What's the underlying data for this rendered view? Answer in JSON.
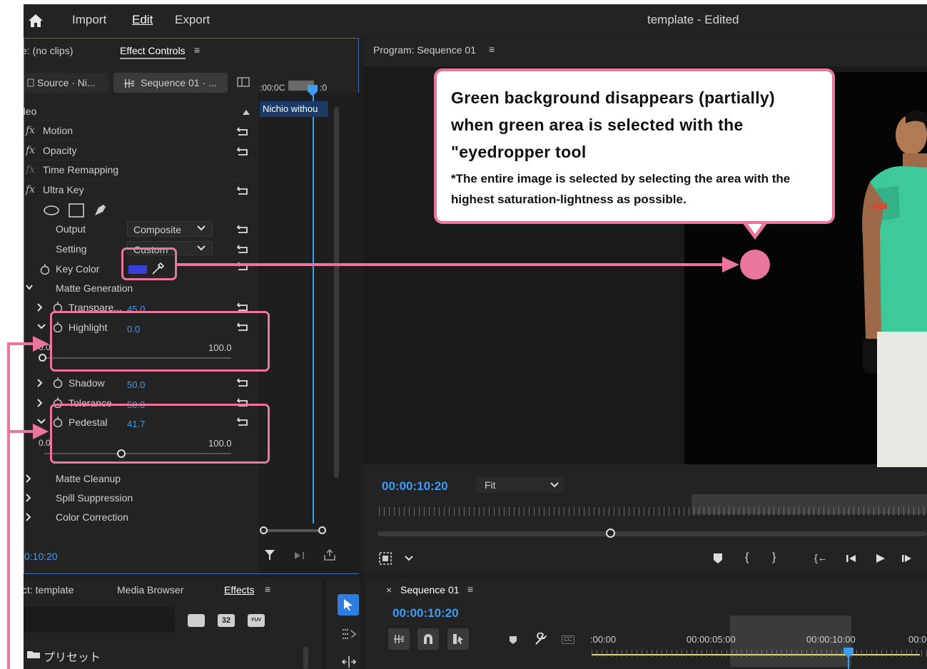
{
  "menu": {
    "import": "Import",
    "edit": "Edit",
    "export": "Export"
  },
  "app_title": "template - Edited",
  "left_panel": {
    "source_tab": "e: (no clips)",
    "effect_controls_tab": "Effect Controls",
    "source_clip_tab": "Source · Ni...",
    "sequence_tab": "Sequence 01 · ...",
    "timeline_tc": ":00:0C",
    "timeline_tc2": ":0",
    "clip_label": "Nichio withou",
    "section_video": "deo",
    "effects": {
      "motion": "Motion",
      "opacity": "Opacity",
      "time_remapping": "Time Remapping",
      "ultra_key": "Ultra Key"
    },
    "output_label": "Output",
    "output_value": "Composite",
    "setting_label": "Setting",
    "setting_value": "Custom",
    "key_color_label": "Key Color",
    "matte_generation": "Matte Generation",
    "transparency_label": "Transpare...",
    "transparency_value": "45.0",
    "highlight_label": "Highlight",
    "highlight_value": "0.0",
    "highlight_min": "0.0",
    "highlight_max": "100.0",
    "shadow_label": "Shadow",
    "shadow_value": "50.0",
    "tolerance_label": "Tolerance",
    "tolerance_value": "50.0",
    "pedestal_label": "Pedestal",
    "pedestal_value": "41.7",
    "pedestal_min": "0.0",
    "pedestal_max": "100.0",
    "matte_cleanup": "Matte Cleanup",
    "spill_suppression": "Spill Suppression",
    "color_correction": "Color Correction",
    "timecode": "0:10:20",
    "key_color_swatch": "#3a3fd6"
  },
  "program": {
    "title": "Program: Sequence 01",
    "timecode": "00:00:10:20",
    "fit": "Fit"
  },
  "bottom_left": {
    "project_tab": "ct: template",
    "media_browser_tab": "Media Browser",
    "effects_tab": "Effects",
    "preset_label": "プリセット",
    "icon_label_1": "32",
    "icon_label_2": "YUV"
  },
  "sequence_panel": {
    "title": "Sequence 01",
    "timecode": "00:00:10:20",
    "ruler_0": ":00:00",
    "ruler_1": "00:00:05:00",
    "ruler_2": "00:00:10:00",
    "ruler_3": "00:0"
  },
  "callout": {
    "heading": "Green background disappears (partially) when green area is selected with the \"eyedropper tool",
    "note": "*The entire image is selected by selecting the area with the highest saturation-lightness as possible."
  },
  "colors": {
    "accent_blue": "#3f9cf4",
    "annotation_pink": "#e8769f",
    "jersey_green": "#3ec99a"
  }
}
